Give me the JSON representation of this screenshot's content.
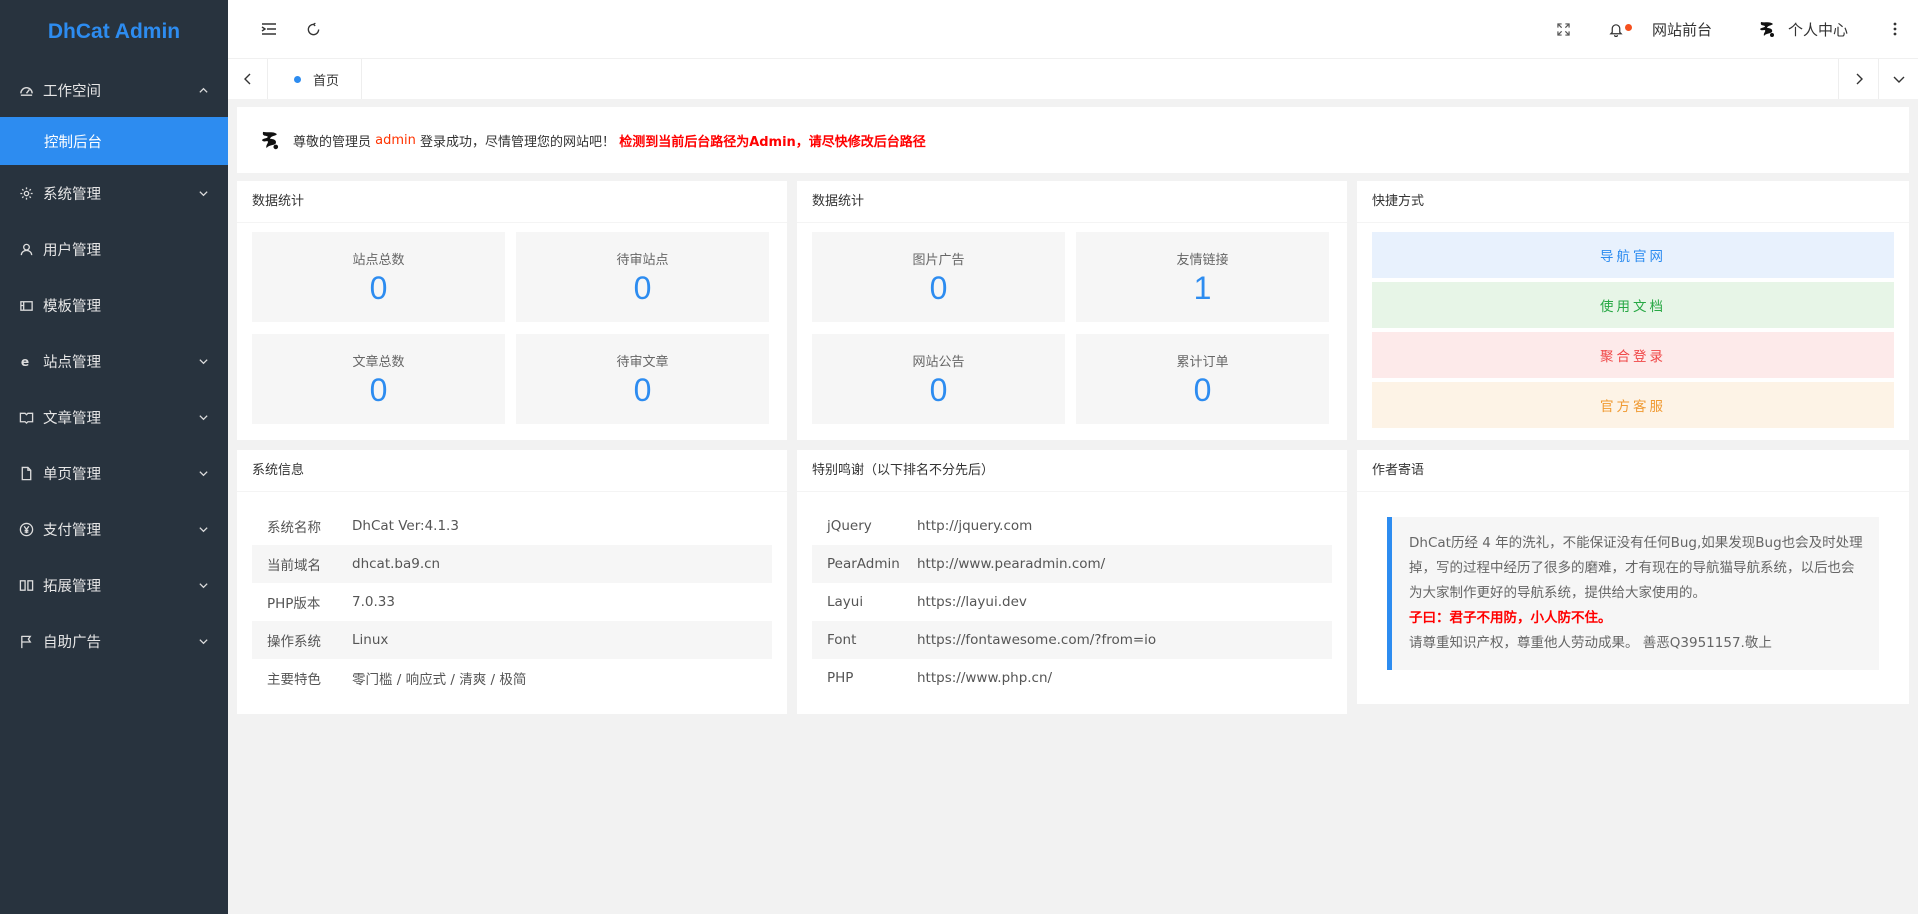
{
  "app": {
    "title": "DhCat Admin"
  },
  "sidebar": {
    "items": [
      {
        "label": "工作空间",
        "icon": "dashboard-icon",
        "open": true
      },
      {
        "label": "系统管理",
        "icon": "gear-icon"
      },
      {
        "label": "用户管理",
        "icon": "user-icon"
      },
      {
        "label": "模板管理",
        "icon": "template-icon"
      },
      {
        "label": "站点管理",
        "icon": "ie-icon"
      },
      {
        "label": "文章管理",
        "icon": "book-icon"
      },
      {
        "label": "单页管理",
        "icon": "file-icon"
      },
      {
        "label": "支付管理",
        "icon": "yen-icon"
      },
      {
        "label": "拓展管理",
        "icon": "extension-icon"
      },
      {
        "label": "自助广告",
        "icon": "flag-icon"
      }
    ],
    "sub_active": "控制后台"
  },
  "header": {
    "frontend_label": "网站前台",
    "user_label": "个人中心"
  },
  "tabs": [
    {
      "label": "首页"
    }
  ],
  "notice": {
    "prefix": "尊敬的管理员",
    "username": "admin",
    "middle": "登录成功，尽情管理您的网站吧！",
    "warning": "检测到当前后台路径为Admin，请尽快修改后台路径"
  },
  "stats1": {
    "title": "数据统计",
    "items": [
      {
        "label": "站点总数",
        "value": "0"
      },
      {
        "label": "待审站点",
        "value": "0"
      },
      {
        "label": "文章总数",
        "value": "0"
      },
      {
        "label": "待审文章",
        "value": "0"
      }
    ]
  },
  "stats2": {
    "title": "数据统计",
    "items": [
      {
        "label": "图片广告",
        "value": "0"
      },
      {
        "label": "友情链接",
        "value": "1"
      },
      {
        "label": "网站公告",
        "value": "0"
      },
      {
        "label": "累计订单",
        "value": "0"
      }
    ]
  },
  "quick": {
    "title": "快捷方式",
    "buttons": [
      {
        "label": "导航官网",
        "bg": "#e8f1fd",
        "color": "#2d8cf0"
      },
      {
        "label": "使用文档",
        "bg": "#e7f5e7",
        "color": "#27a844"
      },
      {
        "label": "聚合登录",
        "bg": "#fdeaea",
        "color": "#f04747"
      },
      {
        "label": "官方客服",
        "bg": "#fdf3e6",
        "color": "#f09a32"
      }
    ]
  },
  "sysinfo": {
    "title": "系统信息",
    "rows": [
      {
        "k": "系统名称",
        "v": "DhCat Ver:4.1.3"
      },
      {
        "k": "当前域名",
        "v": "dhcat.ba9.cn"
      },
      {
        "k": "PHP版本",
        "v": "7.0.33"
      },
      {
        "k": "操作系统",
        "v": "Linux"
      },
      {
        "k": "主要特色",
        "v": "零门槛 / 响应式 / 清爽 / 极简"
      }
    ]
  },
  "thanks": {
    "title": "特别鸣谢（以下排名不分先后）",
    "rows": [
      {
        "k": "jQuery",
        "v": "http://jquery.com"
      },
      {
        "k": "PearAdmin",
        "v": "http://www.pearadmin.com/"
      },
      {
        "k": "Layui",
        "v": "https://layui.dev"
      },
      {
        "k": "Font",
        "v": "https://fontawesome.com/?from=io"
      },
      {
        "k": "PHP",
        "v": "https://www.php.cn/"
      }
    ]
  },
  "author": {
    "title": "作者寄语",
    "text1": "DhCat历经 4 年的洗礼，不能保证没有任何Bug,如果发现Bug也会及时处理掉，写的过程中经历了很多的磨难，才有现在的导航猫导航系统，以后也会为大家制作更好的导航系统，提供给大家使用的。",
    "highlight": "子曰：君子不用防，小人防不住。",
    "text2": "请尊重知识产权，尊重他人劳动成果。 善恶Q3951157.敬上"
  },
  "colors": {
    "accent": "#2d8cf0",
    "sidebar_bg": "#28333e",
    "warn": "#ff0000",
    "notify_dot": "#f5501e"
  }
}
